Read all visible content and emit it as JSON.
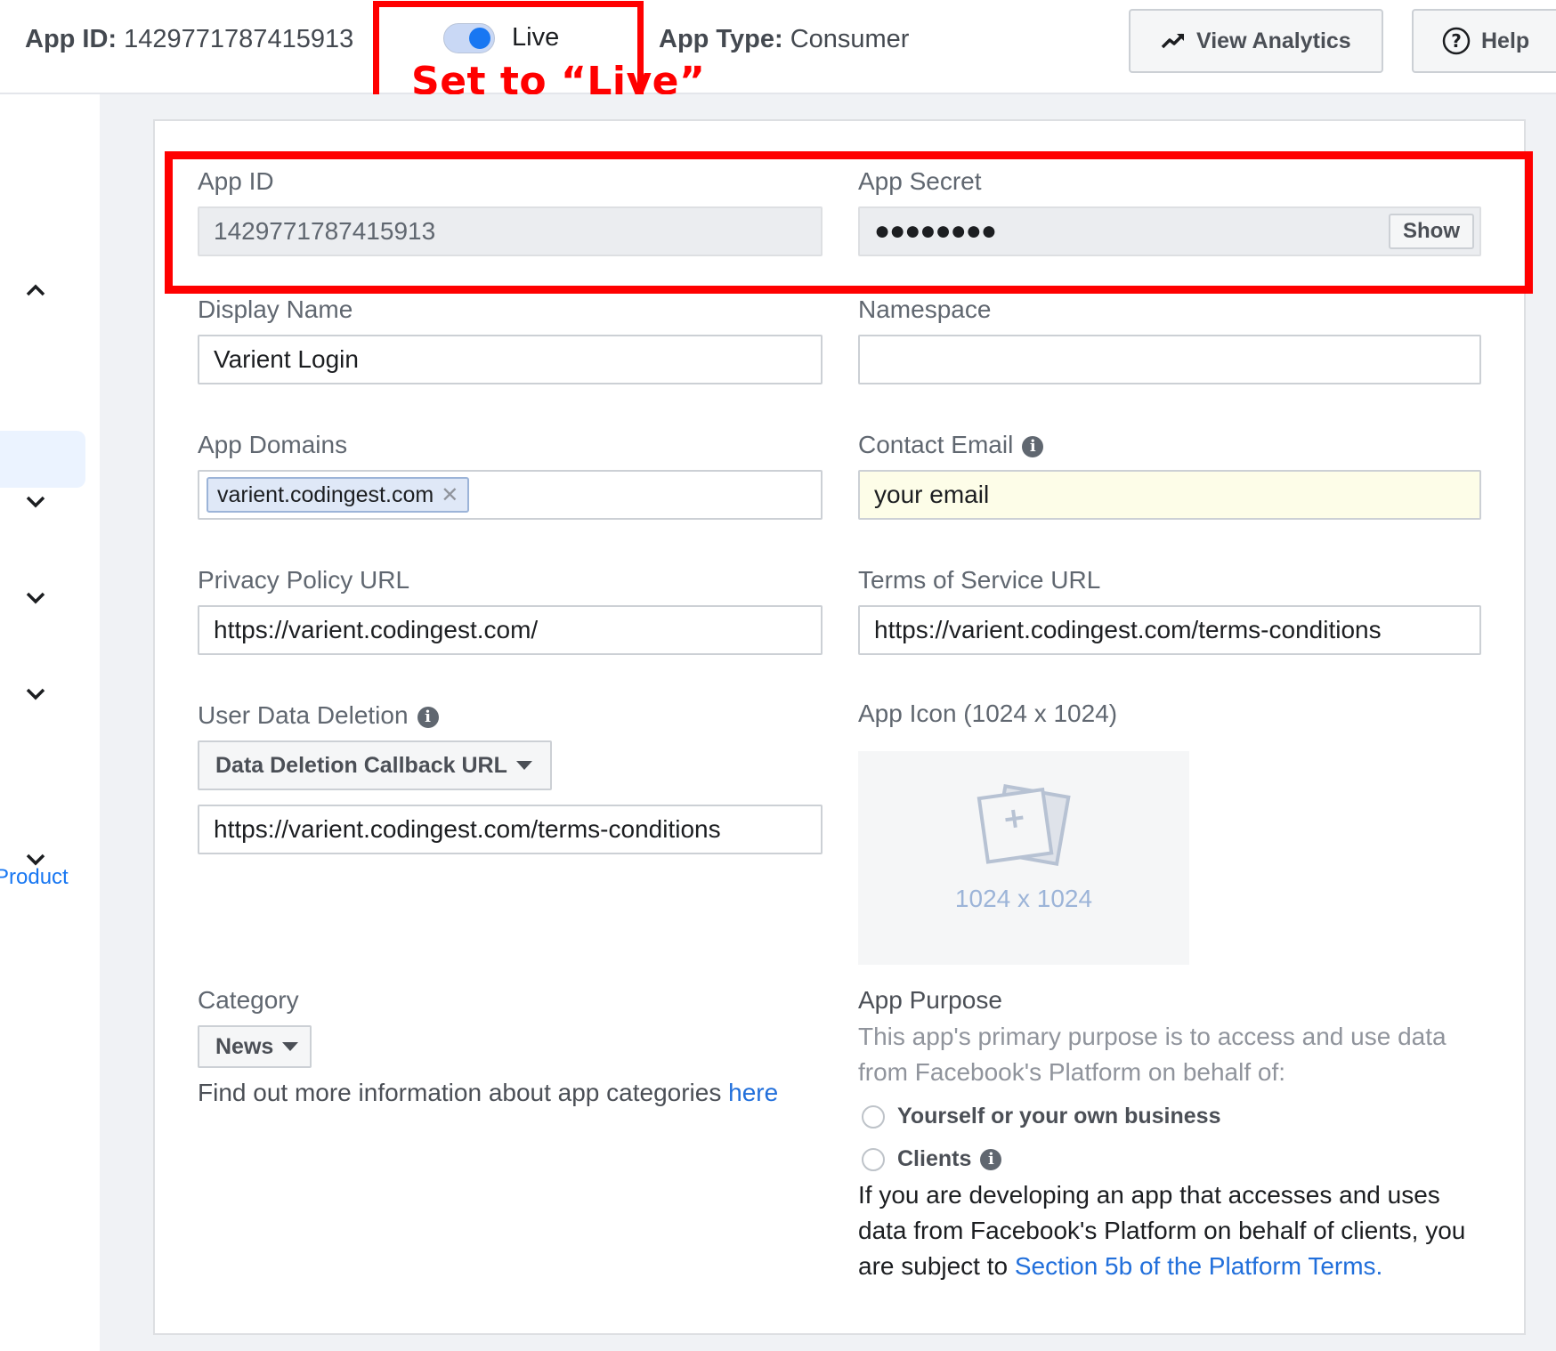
{
  "header": {
    "app_id_label": "App ID:",
    "app_id_value": "1429771787415913",
    "live_label": "Live",
    "annotation_live": "Set to “Live”",
    "app_type_label": "App Type:",
    "app_type_value": "Consumer",
    "view_analytics": "View Analytics",
    "help": "Help"
  },
  "sidebar": {
    "product_link": "Product"
  },
  "form": {
    "app_id_label": "App ID",
    "app_id_value": "1429771787415913",
    "app_secret_label": "App Secret",
    "app_secret_mask": "●●●●●●●●",
    "show_button": "Show",
    "display_name_label": "Display Name",
    "display_name_value": "Varient Login",
    "namespace_label": "Namespace",
    "namespace_value": "",
    "app_domains_label": "App Domains",
    "app_domain_tag": "varient.codingest.com",
    "contact_email_label": "Contact Email",
    "contact_email_value": "your email",
    "privacy_label": "Privacy Policy URL",
    "privacy_value": "https://varient.codingest.com/",
    "tos_label": "Terms of Service URL",
    "tos_value": "https://varient.codingest.com/terms-conditions",
    "user_data_deletion_label": "User Data Deletion",
    "data_deletion_dropdown": "Data Deletion Callback URL",
    "data_deletion_value": "https://varient.codingest.com/terms-conditions",
    "app_icon_label": "App Icon (1024 x 1024)",
    "app_icon_placeholder": "1024 x 1024",
    "category_label": "Category",
    "category_value": "News",
    "category_help_text": "Find out more information about app categories ",
    "category_help_link": "here",
    "app_purpose_label": "App Purpose",
    "app_purpose_desc_1": "This app's primary purpose is to access and use data",
    "app_purpose_desc_2": "from Facebook's Platform on behalf of:",
    "radio_yourself": "Yourself or your own business",
    "radio_clients": "Clients",
    "clients_text_1": "If you are developing an app that accesses and uses",
    "clients_text_2": "data from Facebook's Platform on behalf of clients, you",
    "clients_text_3": "are subject to ",
    "clients_link": "Section 5b of the Platform Terms."
  },
  "colors": {
    "accent": "#1877f2",
    "annotation": "#ff0000",
    "link": "#216fdb"
  }
}
